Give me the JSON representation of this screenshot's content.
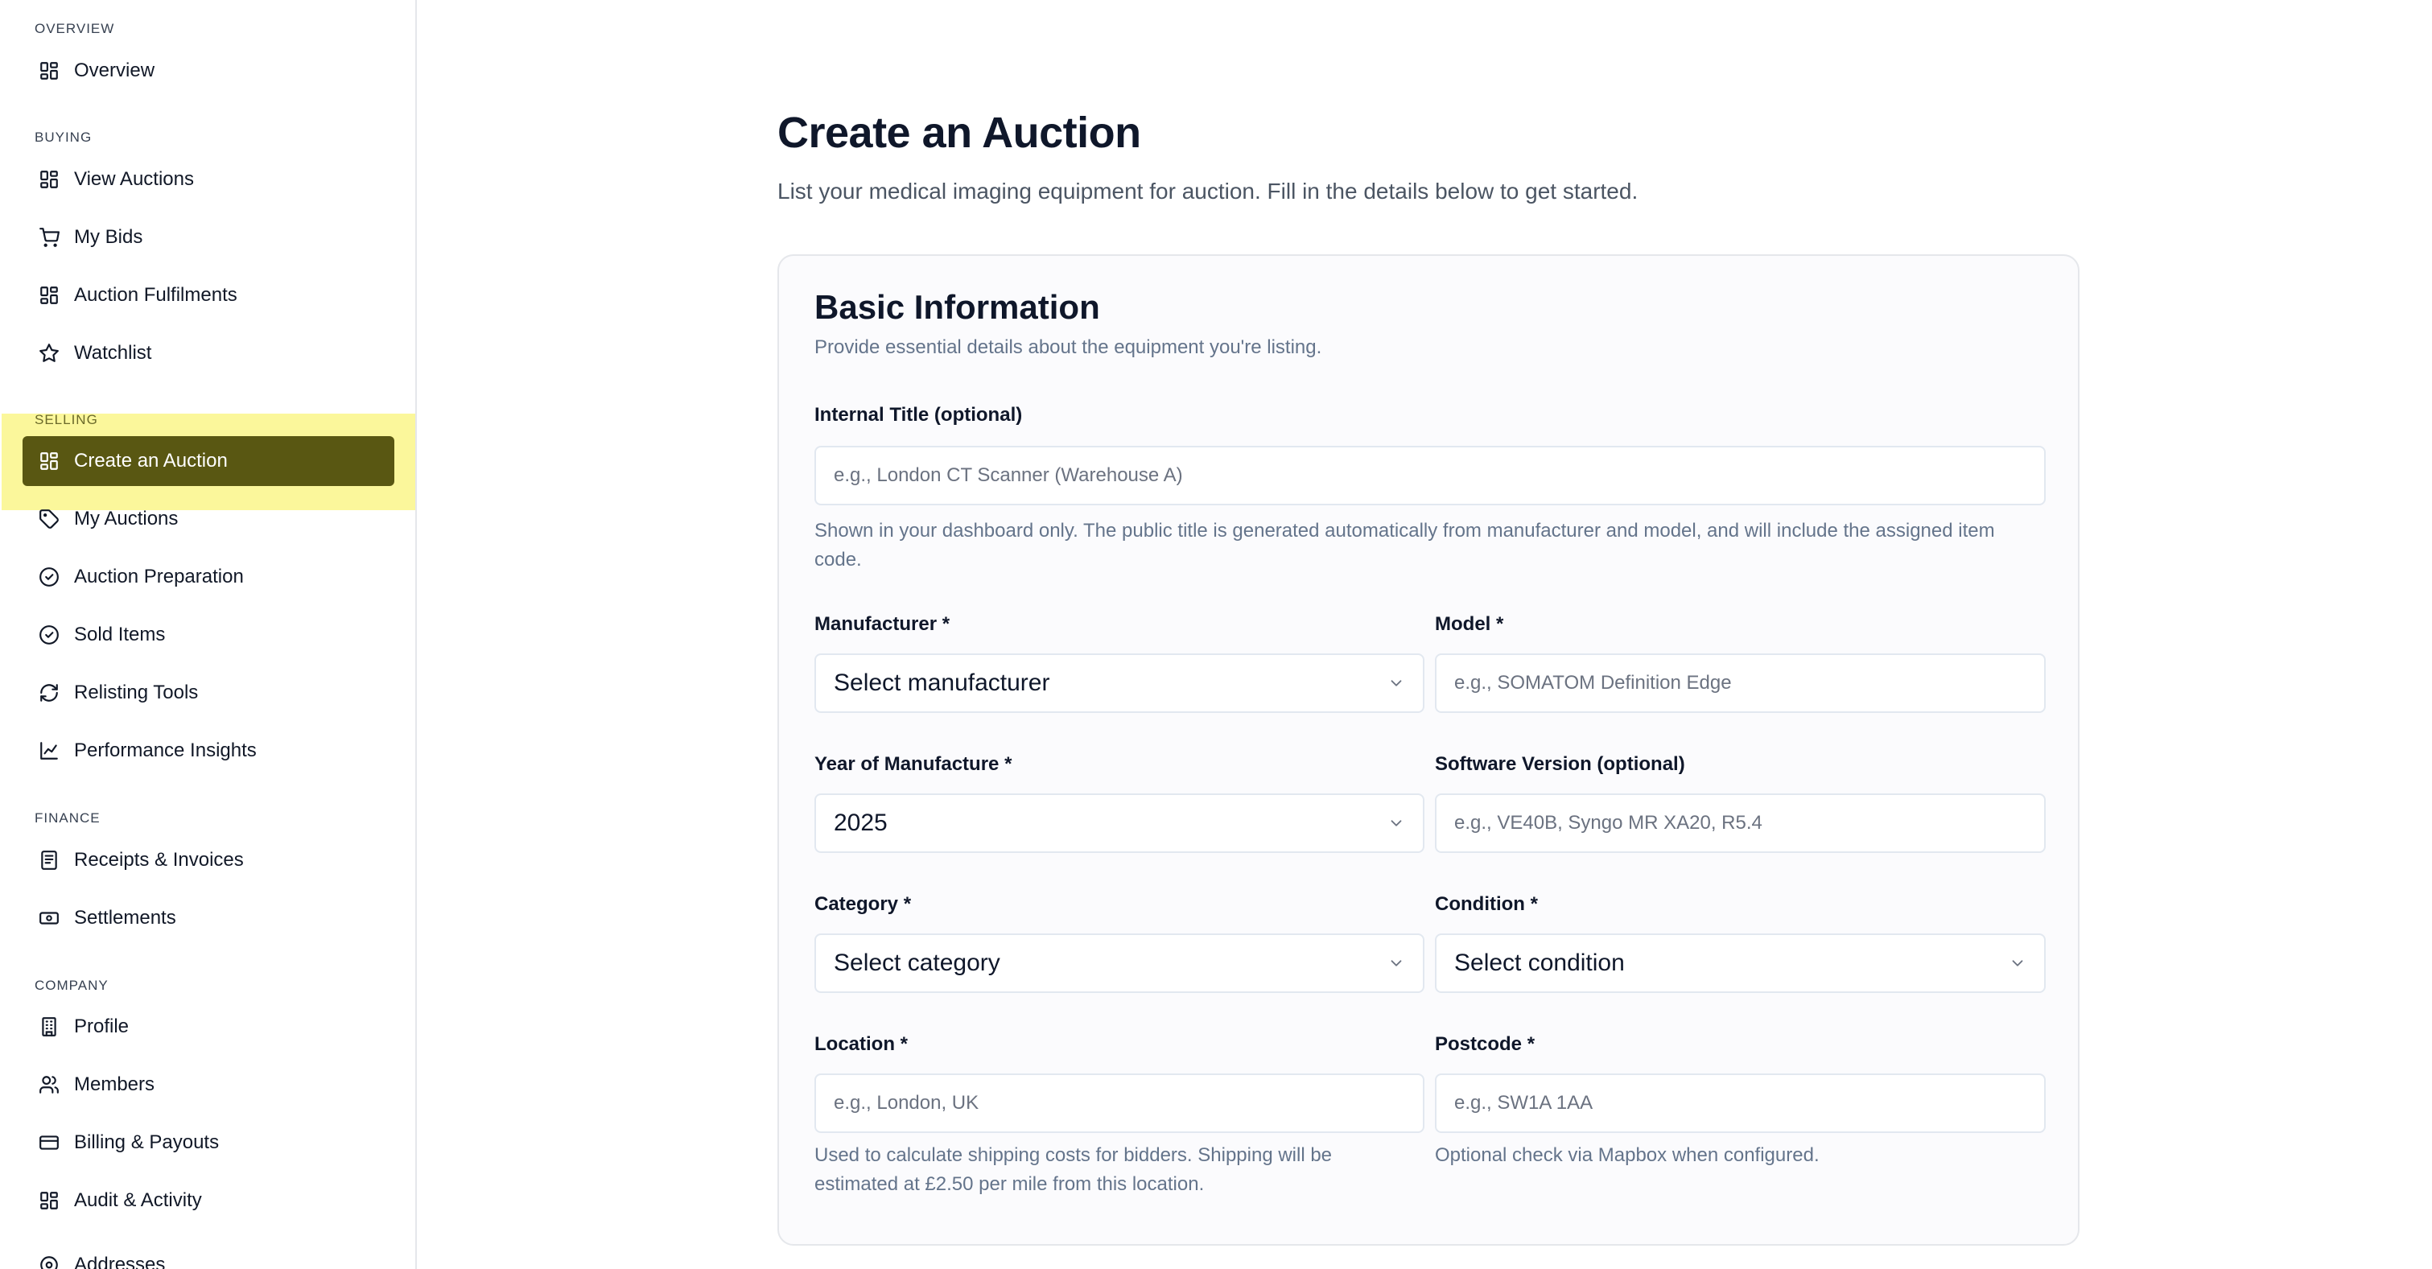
{
  "sidebar": {
    "sections": {
      "overview": "OVERVIEW",
      "buying": "BUYING",
      "selling": "SELLING",
      "finance": "FINANCE",
      "company": "COMPANY"
    },
    "items": {
      "overview": "Overview",
      "view_auctions": "View Auctions",
      "my_bids": "My Bids",
      "auction_fulfilments": "Auction Fulfilments",
      "watchlist": "Watchlist",
      "create_auction": "Create an Auction",
      "my_auctions": "My Auctions",
      "auction_preparation": "Auction Preparation",
      "sold_items": "Sold Items",
      "relisting_tools": "Relisting Tools",
      "performance_insights": "Performance Insights",
      "receipts_invoices": "Receipts & Invoices",
      "settlements": "Settlements",
      "profile": "Profile",
      "members": "Members",
      "billing_payouts": "Billing & Payouts",
      "audit_activity": "Audit & Activity",
      "addresses": "Addresses"
    },
    "active_item": "create_auction",
    "colors": {
      "active_bg": "#595712",
      "highlight": "#fbf79b"
    }
  },
  "header": {
    "title": "Create an Auction",
    "subtitle": "List your medical imaging equipment for auction. Fill in the details below to get started."
  },
  "basic_info": {
    "title": "Basic Information",
    "description": "Provide essential details about the equipment you're listing.",
    "internal_title": {
      "label": "Internal Title (optional)",
      "placeholder": "e.g., London CT Scanner (Warehouse A)",
      "helper": "Shown in your dashboard only. The public title is generated automatically from manufacturer and model, and will include the assigned item code."
    },
    "manufacturer": {
      "label": "Manufacturer *",
      "value": "Select manufacturer"
    },
    "model": {
      "label": "Model *",
      "placeholder": "e.g., SOMATOM Definition Edge"
    },
    "year": {
      "label": "Year of Manufacture *",
      "value": "2025"
    },
    "software_version": {
      "label": "Software Version (optional)",
      "placeholder": "e.g., VE40B, Syngo MR XA20, R5.4"
    },
    "category": {
      "label": "Category *",
      "value": "Select category"
    },
    "condition": {
      "label": "Condition *",
      "value": "Select condition"
    },
    "location": {
      "label": "Location *",
      "placeholder": "e.g., London, UK",
      "helper": "Used to calculate shipping costs for bidders. Shipping will be estimated at £2.50 per mile from this location."
    },
    "postcode": {
      "label": "Postcode *",
      "placeholder": "e.g., SW1A 1AA",
      "helper": "Optional check via Mapbox when configured."
    }
  }
}
